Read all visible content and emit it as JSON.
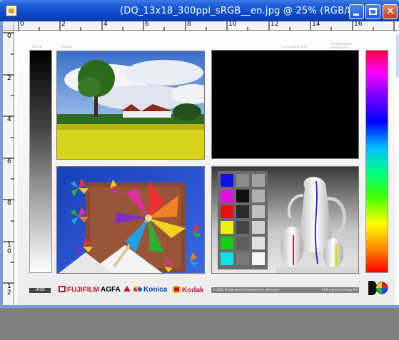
{
  "window": {
    "title": "(DQ_13x18_300ppi_sRGB__en.jpg @ 25% (RGB/8",
    "buttons": {
      "minimize": "minimize",
      "maximize": "maximize",
      "close": "close"
    }
  },
  "rulers": {
    "horizontal": [
      "0",
      "2",
      "4",
      "6",
      "8",
      "10",
      "12",
      "14",
      "16"
    ],
    "vertical": [
      "0",
      "2",
      "4",
      "6",
      "8",
      "1\n0",
      "1\n2"
    ]
  },
  "document": {
    "gray_wedge_label": "300 dpi",
    "top_label": "Hinweis",
    "top_right_label": "Photoindustrie-Verband e.V.",
    "top_right_small": "no creasing sizes",
    "srgb_badge": "sRGB",
    "brands": {
      "fujifilm": "FUJIFILM",
      "agfa": "AGFA",
      "konica": "Konica",
      "kodak": "Kodak"
    },
    "footer_left": "© 2002 Photoindustrie-Verband e.V., Germany",
    "footer_right": "RGB reference image file",
    "colors": {
      "fuji_red": "#c8102e",
      "konica_blue": "#0049a8",
      "kodak_yellow": "#ffc20e",
      "kodak_red": "#c8102e"
    }
  }
}
